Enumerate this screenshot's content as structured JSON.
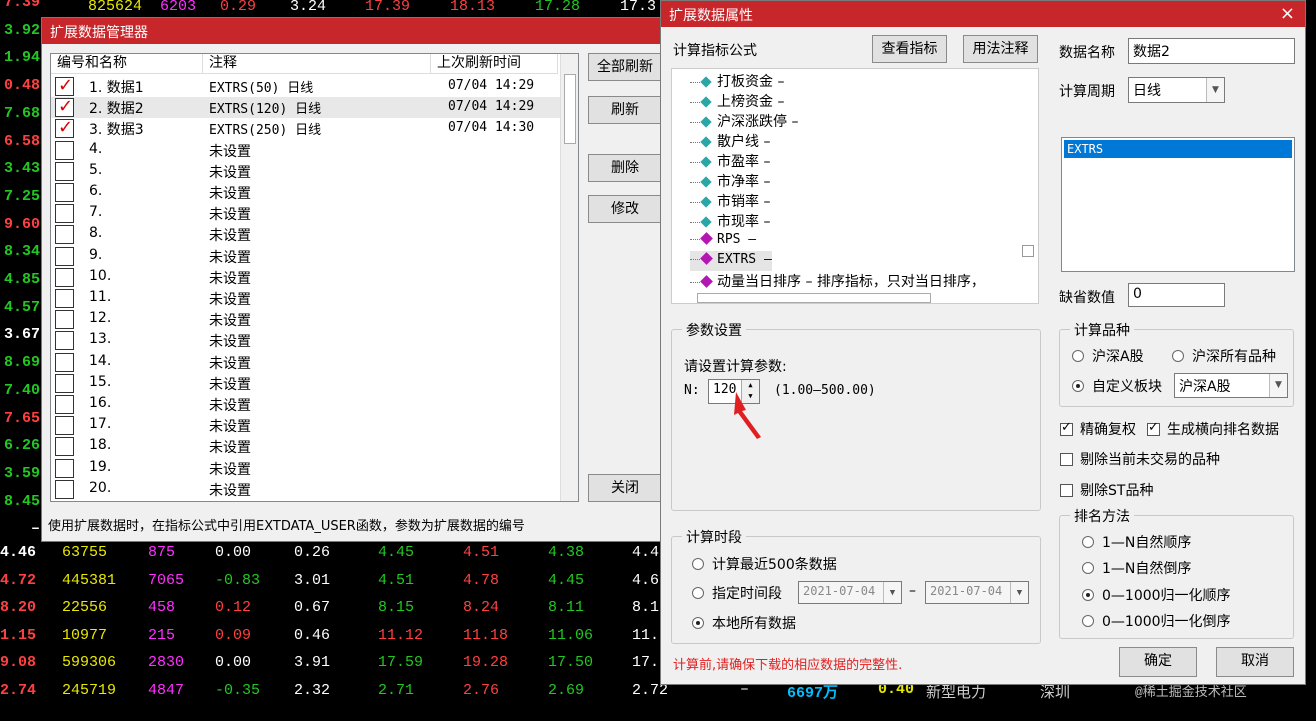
{
  "background": {
    "left_numbers": [
      {
        "text": "7.39",
        "color": "#ff4040"
      },
      {
        "text": "3.92",
        "color": "#22c722"
      },
      {
        "text": "1.94",
        "color": "#22c722"
      },
      {
        "text": "0.48",
        "color": "#ff4040"
      },
      {
        "text": "7.68",
        "color": "#22c722"
      },
      {
        "text": "6.58",
        "color": "#ff4040"
      },
      {
        "text": "3.43",
        "color": "#22c722"
      },
      {
        "text": "7.25",
        "color": "#22c722"
      },
      {
        "text": "9.60",
        "color": "#ff4040"
      },
      {
        "text": "8.34",
        "color": "#22c722"
      },
      {
        "text": "4.85",
        "color": "#22c722"
      },
      {
        "text": "4.57",
        "color": "#22c722"
      },
      {
        "text": "3.67",
        "color": "#ffffff"
      },
      {
        "text": "8.69",
        "color": "#22c722"
      },
      {
        "text": "7.40",
        "color": "#22c722"
      },
      {
        "text": "7.65",
        "color": "#ff4040"
      },
      {
        "text": "6.26",
        "color": "#22c722"
      },
      {
        "text": "3.59",
        "color": "#22c722"
      },
      {
        "text": "8.45",
        "color": "#22c722"
      },
      {
        "text": "–",
        "color": "#ffffff"
      }
    ],
    "top_row": [
      {
        "text": "825624",
        "color": "#e8e800"
      },
      {
        "text": "6203",
        "color": "#ff30ff"
      },
      {
        "text": "0.29",
        "color": "#ff4040"
      },
      {
        "text": "3.24",
        "color": "#ffffff"
      },
      {
        "text": "17.39",
        "color": "#ff4040"
      },
      {
        "text": "18.13",
        "color": "#ff4040"
      },
      {
        "text": "17.28",
        "color": "#22c722"
      },
      {
        "text": "17.3",
        "color": "#ffffff"
      }
    ],
    "rows": [
      {
        "price": "4.46",
        "price_color": "#ffffff",
        "vol": "63755",
        "hand": "875",
        "chg": "0.00",
        "chg_color": "#ffffff",
        "pe": "0.26",
        "open": "4.45",
        "open_color": "#22c722",
        "high": "4.51",
        "high_color": "#ff4040",
        "low": "4.38",
        "low_color": "#22c722",
        "last": "4.4"
      },
      {
        "price": "4.72",
        "price_color": "#ff4040",
        "vol": "445381",
        "hand": "7065",
        "chg": "-0.83",
        "chg_color": "#22c722",
        "pe": "3.01",
        "open": "4.51",
        "open_color": "#22c722",
        "high": "4.78",
        "high_color": "#ff4040",
        "low": "4.45",
        "low_color": "#22c722",
        "last": "4.6"
      },
      {
        "price": "8.20",
        "price_color": "#ff4040",
        "vol": "22556",
        "hand": "458",
        "chg": "0.12",
        "chg_color": "#ff4040",
        "pe": "0.67",
        "open": "8.15",
        "open_color": "#22c722",
        "high": "8.24",
        "high_color": "#ff4040",
        "low": "8.11",
        "low_color": "#22c722",
        "last": "8.1"
      },
      {
        "price": "1.15",
        "price_color": "#ff4040",
        "vol": "10977",
        "hand": "215",
        "chg": "0.09",
        "chg_color": "#ff4040",
        "pe": "0.46",
        "open": "11.12",
        "open_color": "#ff4040",
        "high": "11.18",
        "high_color": "#ff4040",
        "low": "11.06",
        "low_color": "#22c722",
        "last": "11.1"
      },
      {
        "price": "9.08",
        "price_color": "#ff4040",
        "vol": "599306",
        "hand": "2830",
        "chg": "0.00",
        "chg_color": "#ffffff",
        "pe": "3.91",
        "open": "17.59",
        "open_color": "#22c722",
        "high": "19.28",
        "high_color": "#ff4040",
        "low": "17.50",
        "low_color": "#22c722",
        "last": "17.7"
      },
      {
        "price": "2.74",
        "price_color": "#ff4040",
        "vol": "245719",
        "hand": "4847",
        "chg": "-0.35",
        "chg_color": "#22c722",
        "pe": "2.32",
        "open": "2.71",
        "open_color": "#22c722",
        "high": "2.76",
        "high_color": "#ff4040",
        "low": "2.69",
        "low_color": "#22c722",
        "last": "2.72"
      }
    ],
    "bottom_extra": {
      "dash": "–",
      "amount": "6697万",
      "ratio": "0.40",
      "sector": "新型电力",
      "city": "深圳",
      "watermark": "@稀土掘金技术社区"
    }
  },
  "manager": {
    "title": "扩展数据管理器",
    "close": "×",
    "columns": [
      "编号和名称",
      "注释",
      "上次刷新时间"
    ],
    "rows": [
      {
        "no": "1. 数据1",
        "note": "EXTRS(50) 日线",
        "time": "07/04 14:29",
        "checked": true
      },
      {
        "no": "2. 数据2",
        "note": "EXTRS(120) 日线",
        "time": "07/04 14:29",
        "checked": true
      },
      {
        "no": "3. 数据3",
        "note": "EXTRS(250) 日线",
        "time": "07/04 14:30",
        "checked": true
      },
      {
        "no": "4.",
        "note": "未设置",
        "time": "",
        "checked": false
      },
      {
        "no": "5.",
        "note": "未设置",
        "time": "",
        "checked": false
      },
      {
        "no": "6.",
        "note": "未设置",
        "time": "",
        "checked": false
      },
      {
        "no": "7.",
        "note": "未设置",
        "time": "",
        "checked": false
      },
      {
        "no": "8.",
        "note": "未设置",
        "time": "",
        "checked": false
      },
      {
        "no": "9.",
        "note": "未设置",
        "time": "",
        "checked": false
      },
      {
        "no": "10.",
        "note": "未设置",
        "time": "",
        "checked": false
      },
      {
        "no": "11.",
        "note": "未设置",
        "time": "",
        "checked": false
      },
      {
        "no": "12.",
        "note": "未设置",
        "time": "",
        "checked": false
      },
      {
        "no": "13.",
        "note": "未设置",
        "time": "",
        "checked": false
      },
      {
        "no": "14.",
        "note": "未设置",
        "time": "",
        "checked": false
      },
      {
        "no": "15.",
        "note": "未设置",
        "time": "",
        "checked": false
      },
      {
        "no": "16.",
        "note": "未设置",
        "time": "",
        "checked": false
      },
      {
        "no": "17.",
        "note": "未设置",
        "time": "",
        "checked": false
      },
      {
        "no": "18.",
        "note": "未设置",
        "time": "",
        "checked": false
      },
      {
        "no": "19.",
        "note": "未设置",
        "time": "",
        "checked": false
      },
      {
        "no": "20.",
        "note": "未设置",
        "time": "",
        "checked": false
      }
    ],
    "buttons": {
      "refresh_all": "全部刷新",
      "refresh": "刷新",
      "delete": "删除",
      "modify": "修改",
      "close": "关闭"
    },
    "footer": "使用扩展数据时，在指标公式中引用EXTDATA_USER函数，参数为扩展数据的编号"
  },
  "props": {
    "title": "扩展数据属性",
    "close": "×",
    "formula_label": "计算指标公式",
    "view_btn": "查看指标",
    "usage_btn": "用法注释",
    "tree": [
      {
        "text": "打板资金 –",
        "kind": "c"
      },
      {
        "text": "上榜资金 –",
        "kind": "c"
      },
      {
        "text": "沪深涨跌停 –",
        "kind": "c"
      },
      {
        "text": "散户线 –",
        "kind": "c"
      },
      {
        "text": "市盈率 –",
        "kind": "c"
      },
      {
        "text": "市净率 –",
        "kind": "c"
      },
      {
        "text": "市销率 –",
        "kind": "c"
      },
      {
        "text": "市现率 –",
        "kind": "c"
      },
      {
        "text": "RPS –",
        "kind": "p"
      },
      {
        "text": "EXTRS –",
        "kind": "p"
      },
      {
        "text": "动量当日排序 – 排序指标，只对当日排序，",
        "kind": "p"
      }
    ],
    "param_group": "参数设置",
    "param_prompt": "请设置计算参数:",
    "param_name": "N:",
    "param_value": "120",
    "param_range": "(1.00—500.00)",
    "period_group": "计算时段",
    "period_options": [
      "计算最近500条数据",
      "指定时间段",
      "本地所有数据"
    ],
    "date_from": "2021-07-04",
    "date_to": "2021-07-04",
    "date_sep": "–",
    "warning": "计算前,请确保下载的相应数据的完整性.",
    "data_name_label": "数据名称",
    "data_name_value": "数据2",
    "cycle_label": "计算周期",
    "cycle_value": "日线",
    "list_selected": "EXTRS",
    "default_label": "缺省数值",
    "default_value": "0",
    "variety_group": "计算品种",
    "variety_a": "沪深A股",
    "variety_all": "沪深所有品种",
    "variety_custom": "自定义板块",
    "custom_value": "沪深A股",
    "chk_exact": "精确复权",
    "chk_rank": "生成横向排名数据",
    "chk_exclude_untraded": "剔除当前未交易的品种",
    "chk_exclude_st": "剔除ST品种",
    "rank_group": "排名方法",
    "rank_options": [
      "1—N自然顺序",
      "1—N自然倒序",
      "0—1000归一化顺序",
      "0—1000归一化倒序"
    ],
    "ok": "确定",
    "cancel": "取消"
  },
  "colors": {
    "title_red": "#c7262b",
    "select_blue": "#0078d7",
    "warning_red": "#e02020"
  }
}
